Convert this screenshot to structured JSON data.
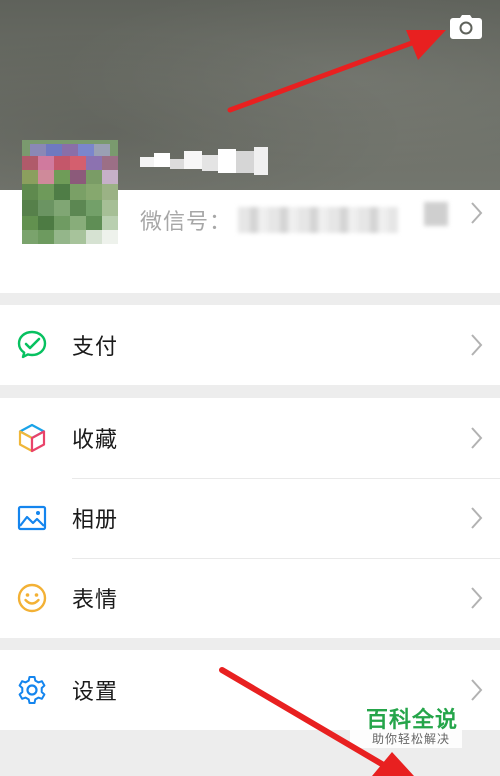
{
  "cover": {
    "camera_icon": "camera-icon"
  },
  "profile": {
    "wechat_id_label": "微信号：",
    "nickname_blurred": true,
    "wechat_id_blurred": true
  },
  "menu": {
    "pay": {
      "label": "支付",
      "icon": "wechat-pay-icon",
      "color": "#07c160"
    },
    "favorites": {
      "label": "收藏",
      "icon": "favorites-cube-icon"
    },
    "album": {
      "label": "相册",
      "icon": "album-image-icon",
      "color": "#1485ee"
    },
    "stickers": {
      "label": "表情",
      "icon": "smiley-icon",
      "color": "#f3b135"
    },
    "settings": {
      "label": "设置",
      "icon": "gear-icon",
      "color": "#1485ee"
    }
  },
  "watermark": {
    "title": "百科全说",
    "subtitle": "助你轻松解决",
    "color": "#25a54a"
  },
  "annotation_color": "#e82020"
}
